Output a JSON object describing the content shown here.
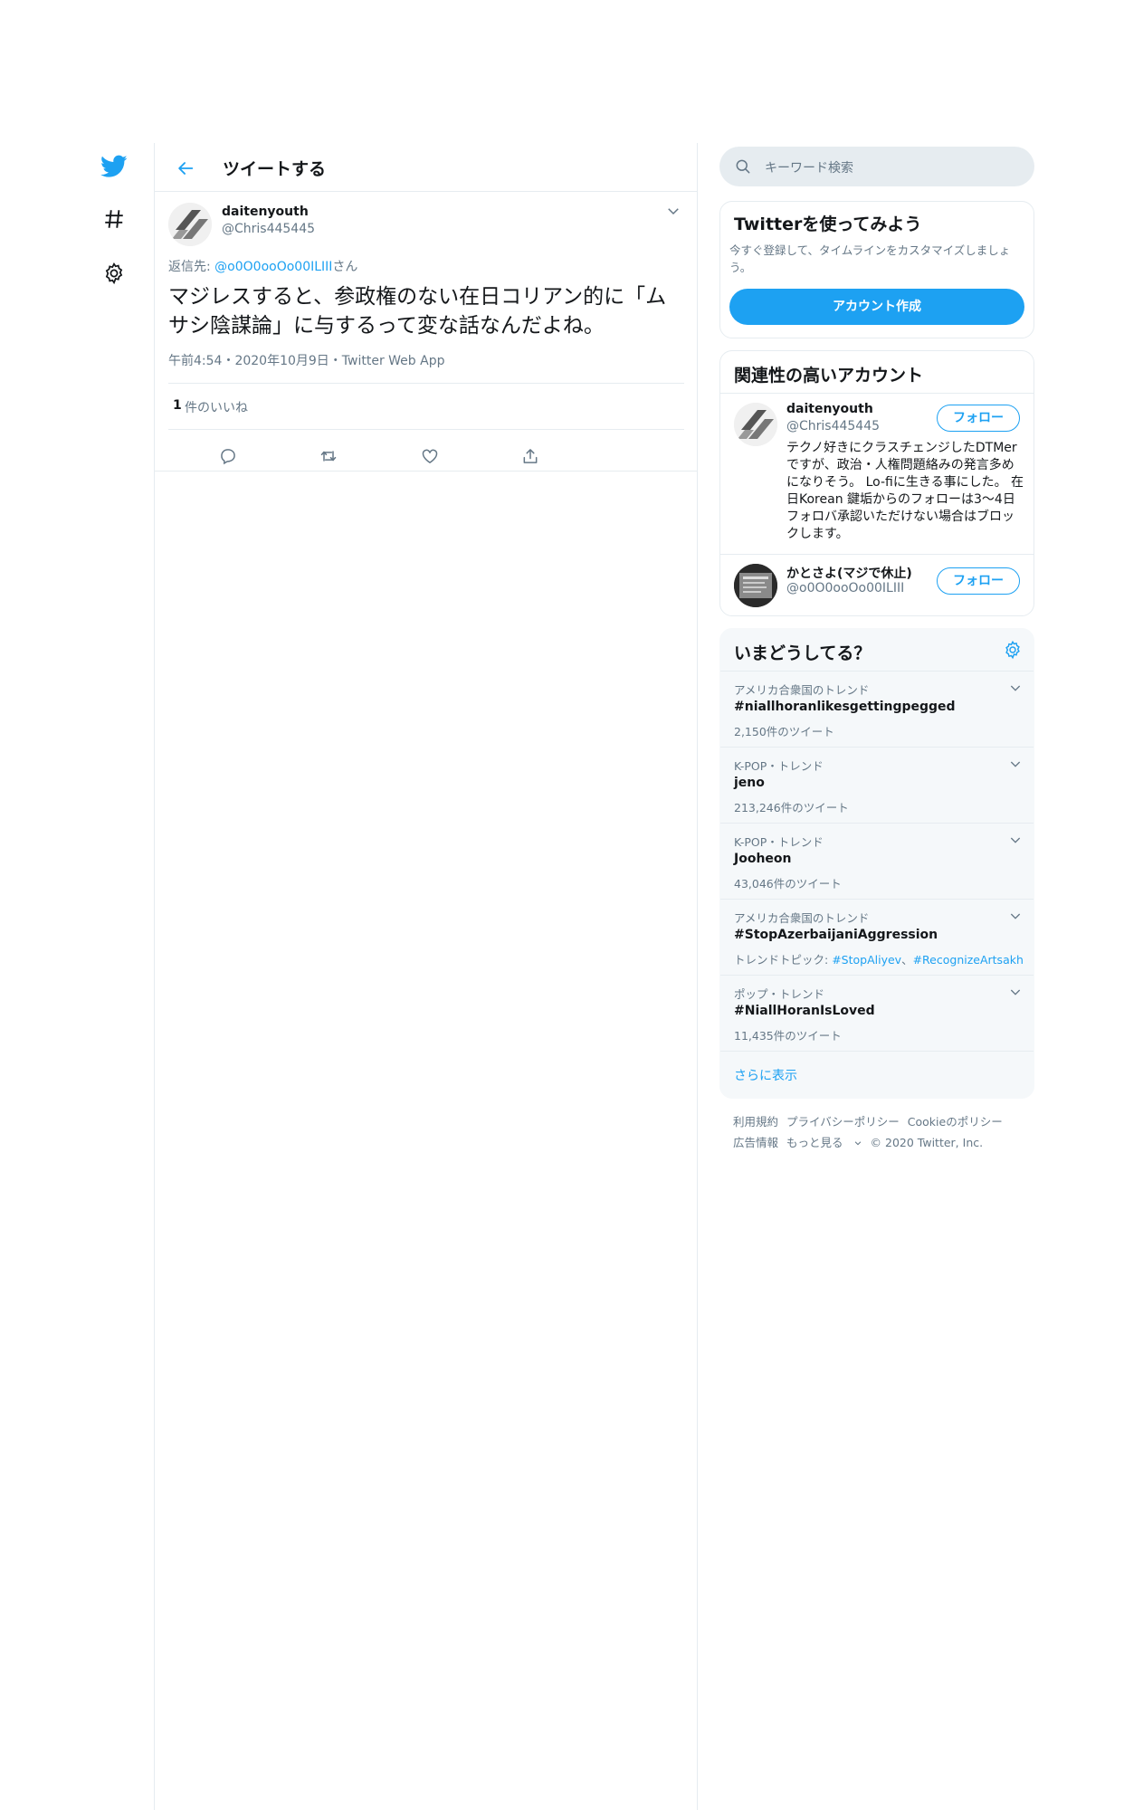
{
  "nav": {
    "items": [
      {
        "name": "twitter-logo"
      },
      {
        "name": "explore-hashtag"
      },
      {
        "name": "settings"
      }
    ]
  },
  "header": {
    "title": "ツイートする"
  },
  "tweet": {
    "display_name": "daitenyouth",
    "handle": "@Chris445445",
    "reply_prefix": "返信先: ",
    "reply_handle": "@o0O0ooOo00ILIII",
    "reply_suffix": "さん",
    "text": "マジレスすると、参政権のない在日コリアン的に「ムサシ陰謀論」に与するって変な話なんだよね。",
    "meta": "午前4:54・2020年10月9日・Twitter Web App",
    "likes_count": "1",
    "likes_label": "件のいいね"
  },
  "search": {
    "placeholder": "キーワード検索"
  },
  "signup": {
    "title": "Twitterを使ってみよう",
    "description": "今すぐ登録して、タイムラインをカスタマイズしましょう。",
    "button": "アカウント作成"
  },
  "relevant": {
    "title": "関連性の高いアカウント",
    "follow_label": "フォロー",
    "accounts": [
      {
        "name": "daitenyouth",
        "handle": "@Chris445445",
        "bio": "テクノ好きにクラスチェンジしたDTMerですが、政治・人権問題絡みの発言多めになりそう。 Lo-fiに生きる事にした。 在日Korean 鍵垢からのフォローは3～4日フォロバ承認いただけない場合はブロックします。"
      },
      {
        "name": "かとさよ(マジで休止)",
        "handle": "@o0O0ooOo00ILIII",
        "bio": ""
      }
    ]
  },
  "trends": {
    "title": "いまどうしてる？",
    "items": [
      {
        "context": "アメリカ合衆国のトレンド",
        "name": "#niallhoranlikesgettingpegged",
        "count": "2,150件のツイート"
      },
      {
        "context": "K-POP・トレンド",
        "name": "jeno",
        "count": "213,246件のツイート"
      },
      {
        "context": "K-POP・トレンド",
        "name": "Jooheon",
        "count": "43,046件のツイート"
      },
      {
        "context": "アメリカ合衆国のトレンド",
        "name": "#StopAzerbaijaniAggression",
        "topics_prefix": "トレンドトピック: ",
        "topic1": "#StopAliyev",
        "topic_sep": "、",
        "topic2": "#RecognizeArtsakh"
      },
      {
        "context": "ポップ・トレンド",
        "name": "#NiallHoranIsLoved",
        "count": "11,435件のツイート"
      }
    ],
    "more": "さらに表示"
  },
  "footer": {
    "links": [
      "利用規約",
      "プライバシーポリシー",
      "Cookieのポリシー"
    ],
    "row2": [
      "広告情報",
      "もっと見る",
      "© 2020 Twitter, Inc."
    ]
  },
  "colors": {
    "accent": "#1da1f2",
    "text": "#14171a",
    "muted": "#657786",
    "border": "#e6ecf0"
  }
}
